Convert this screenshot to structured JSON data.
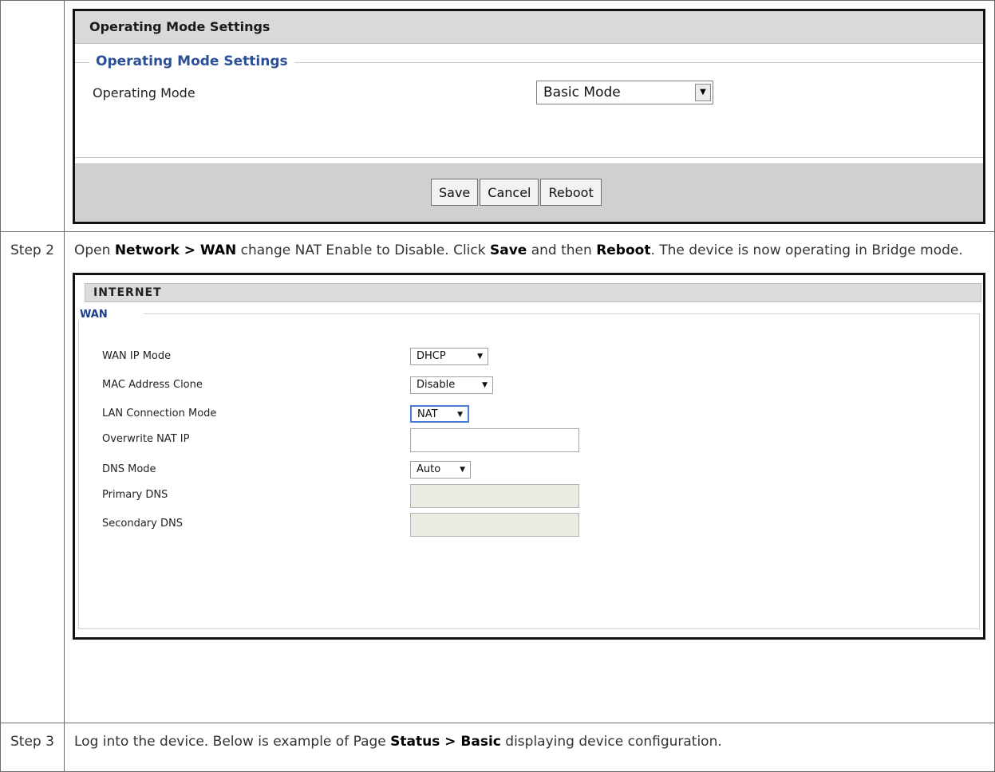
{
  "step2": {
    "label": "Step 2",
    "text_a": "Open ",
    "bold_a": "Network > WAN",
    "text_b": " change NAT Enable to Disable. Click ",
    "bold_b": "Save",
    "text_c": " and then ",
    "bold_c": "Reboot",
    "text_d": ". The device is now operating in Bridge mode."
  },
  "step3": {
    "label": "Step 3",
    "text_a": "Log into the device. Below is example of Page ",
    "bold_a": "Status > Basic",
    "text_b": " displaying device configuration."
  },
  "operating_mode_panel": {
    "header": "Operating Mode Settings",
    "fieldset_title": "Operating Mode Settings",
    "mode_label": "Operating Mode",
    "mode_value": "Basic Mode",
    "buttons": {
      "save": "Save",
      "cancel": "Cancel",
      "reboot": "Reboot"
    }
  },
  "internet_panel": {
    "header": "INTERNET",
    "section_title": "WAN",
    "rows": {
      "wan_ip_mode": {
        "label": "WAN IP Mode",
        "value": "DHCP"
      },
      "mac_clone": {
        "label": "MAC Address Clone",
        "value": "Disable"
      },
      "lan_mode": {
        "label": "LAN Connection Mode",
        "value": "NAT"
      },
      "overwrite_nat": {
        "label": "Overwrite NAT IP",
        "value": ""
      },
      "dns_mode": {
        "label": "DNS Mode",
        "value": "Auto"
      },
      "primary_dns": {
        "label": "Primary DNS",
        "value": ""
      },
      "secondary_dns": {
        "label": "Secondary DNS",
        "value": ""
      }
    },
    "dropdown_glyph": "▼"
  },
  "colors": {
    "fieldset_title": "#2d4f96",
    "wan_title": "#1f3d8f",
    "header_bg": "#d9d9d9",
    "footer_bg": "#d0d0d0",
    "focus_border": "#4a7cd4"
  }
}
